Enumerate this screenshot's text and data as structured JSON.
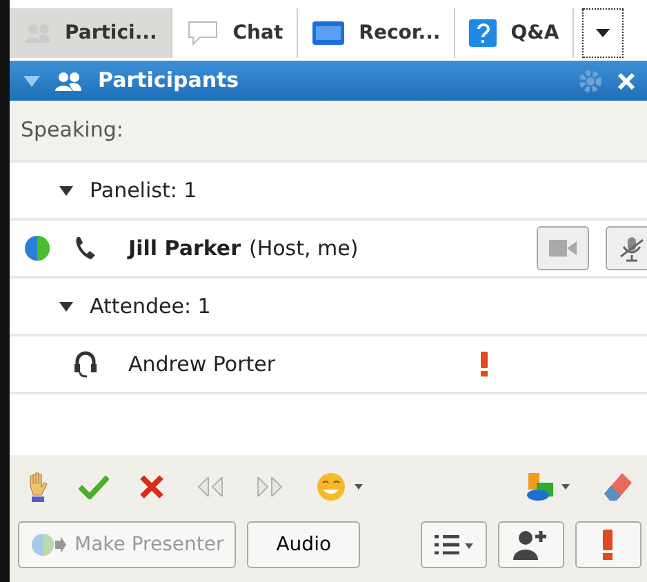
{
  "tabs": [
    {
      "label": "Partici...",
      "selected": true
    },
    {
      "label": "Chat",
      "selected": false
    },
    {
      "label": "Recor...",
      "selected": false
    },
    {
      "label": "Q&A",
      "selected": false
    }
  ],
  "panel": {
    "title": "Participants",
    "expanded": true
  },
  "speaking": "Speaking:",
  "groups": [
    {
      "label": "Panelist: 1",
      "expanded": true,
      "members": [
        {
          "kind": "phone",
          "name": "Jill Parker",
          "role": "(Host, me)",
          "presenter": true,
          "alert": false,
          "video_button": true,
          "mute_button": true
        }
      ]
    },
    {
      "label": "Attendee: 1",
      "expanded": true,
      "members": [
        {
          "kind": "headset",
          "name": "Andrew Porter",
          "presenter": false,
          "alert": true,
          "video_button": false,
          "mute_button": false
        }
      ]
    }
  ],
  "toolbar": [
    {
      "kind": "hand",
      "disabled": false
    },
    {
      "kind": "check",
      "disabled": false
    },
    {
      "kind": "cross",
      "disabled": false
    },
    {
      "kind": "rewind",
      "disabled": true
    },
    {
      "kind": "forward",
      "disabled": true
    },
    {
      "kind": "emoji",
      "disabled": false
    },
    {
      "kind": "shapes",
      "disabled": false
    },
    {
      "kind": "eraser",
      "disabled": false
    }
  ],
  "buttons": [
    {
      "label": "Make Presenter",
      "disabled": true
    },
    {
      "label": "Audio",
      "disabled": false
    }
  ]
}
